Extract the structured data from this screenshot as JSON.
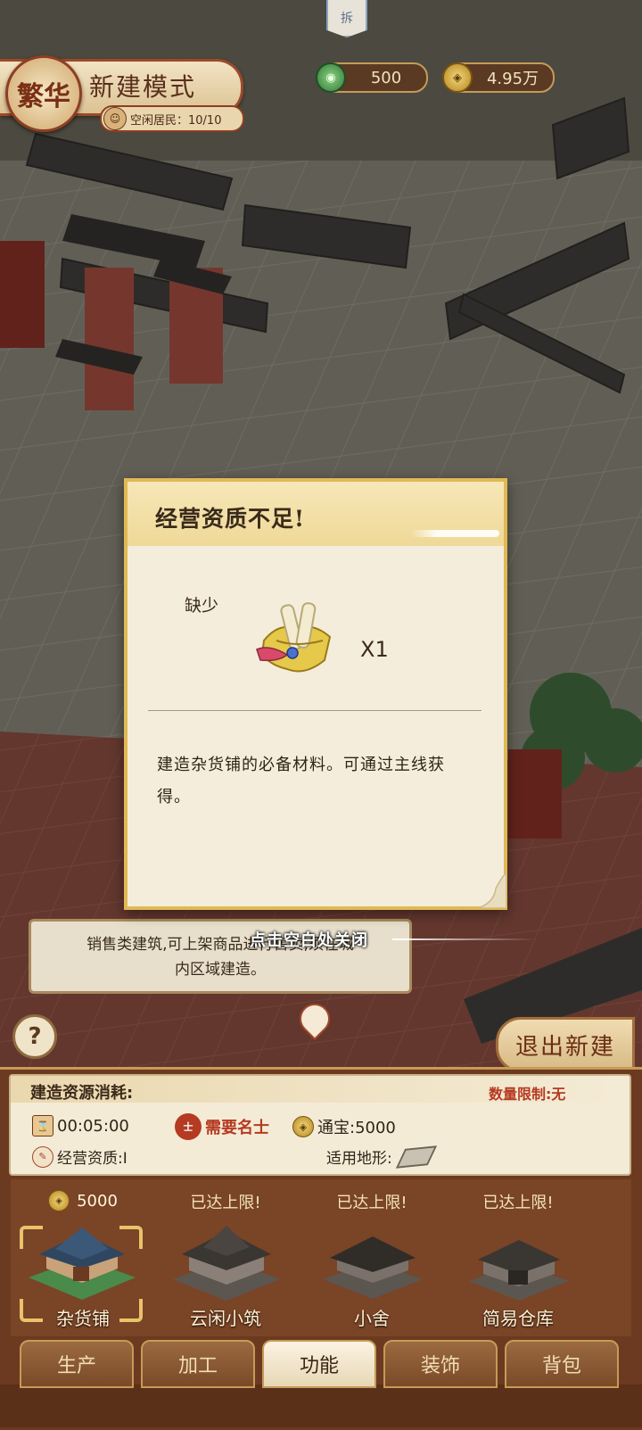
{
  "hud": {
    "emblem_text": "繁华",
    "mode_title": "新建模式",
    "idle_residents": "空闲居民：10/10",
    "flag_text": "拆",
    "jade_amount": "500",
    "money_amount": "4.95万"
  },
  "tip": {
    "text_line1": "销售类建筑,可上架商品进行售卖,须在城",
    "text_line2": "内区域建造。",
    "close_hint": "点击空白处关闭"
  },
  "exit_button": "退出新建",
  "help_button": "?",
  "cost": {
    "title": "建造资源消耗:",
    "limit": "数量限制:无",
    "time": "00:05:00",
    "need": "需要名士",
    "tongbao": "通宝:5000",
    "qualification": "经营资质:I",
    "terrain_label": "适用地形:"
  },
  "buildings": [
    {
      "top_label": "5000",
      "name": "杂货铺",
      "selected": true
    },
    {
      "top_label": "已达上限!",
      "name": "云闲小筑",
      "selected": false
    },
    {
      "top_label": "已达上限!",
      "name": "小舍",
      "selected": false
    },
    {
      "top_label": "已达上限!",
      "name": "简易仓库",
      "selected": false
    }
  ],
  "tabs": [
    "生产",
    "加工",
    "功能",
    "装饰",
    "背包"
  ],
  "active_tab": "功能",
  "modal": {
    "title": "经营资质不足!",
    "lack_label": "缺少",
    "item_icon": "scroll-icon",
    "quantity": "X1",
    "description": "建造杂货铺的必备材料。可通过主线获得。"
  },
  "colors": {
    "modal_border": "#e0b954",
    "panel_brown": "#6b3a20",
    "warning_red": "#b53a22"
  }
}
